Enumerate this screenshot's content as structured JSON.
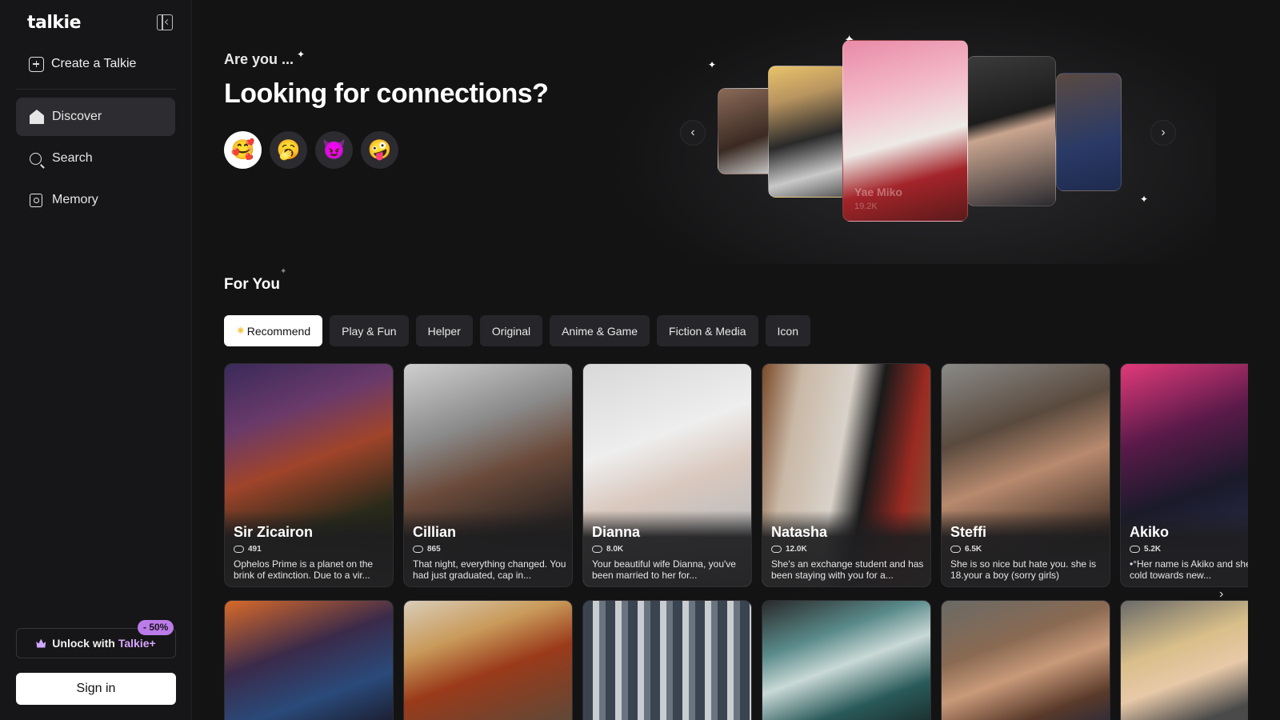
{
  "app": {
    "logo": "talkie"
  },
  "sidebar": {
    "create_label": "Create a Talkie",
    "items": [
      {
        "label": "Discover",
        "icon": "home-icon",
        "active": true
      },
      {
        "label": "Search",
        "icon": "search-icon"
      },
      {
        "label": "Memory",
        "icon": "memory-icon"
      }
    ],
    "unlock_label": "Unlock with ",
    "unlock_brand": "Talkie+",
    "discount_badge": "- 50%",
    "signin_label": "Sign in"
  },
  "hero": {
    "eyebrow": "Are you ...",
    "title": "Looking for connections?",
    "moods": [
      "🥰",
      "🥱",
      "😈",
      "🤪"
    ],
    "featured_caption": "Yae Miko",
    "featured_count": "19.2K"
  },
  "for_you": {
    "title": "For You",
    "tabs": [
      "Recommend",
      "Play & Fun",
      "Helper",
      "Original",
      "Anime & Game",
      "Fiction & Media",
      "Icon"
    ]
  },
  "cards": [
    {
      "name": "Sir Zicairon",
      "count": "491",
      "desc": "Ophelos Prime is a planet on the brink of extinction. Due to a vir..."
    },
    {
      "name": "Cillian",
      "count": "865",
      "desc": "That night, everything changed. You had just graduated, cap in..."
    },
    {
      "name": "Dianna",
      "count": "8.0K",
      "desc": "Your beautiful wife Dianna, you've been married to her for..."
    },
    {
      "name": "Natasha",
      "count": "12.0K",
      "desc": "She's an exchange student and has been staying with you for a..."
    },
    {
      "name": "Steffi",
      "count": "6.5K",
      "desc": "She is so nice but hate you. she is 18.your a boy (sorry girls)"
    },
    {
      "name": "Akiko",
      "count": "5.2K",
      "desc": "•°Her name is Akiko and she is very cold towards new..."
    }
  ],
  "colors": {
    "accent_purple": "#bb7be8",
    "bg": "#131314",
    "sidebar_bg": "#161618"
  }
}
